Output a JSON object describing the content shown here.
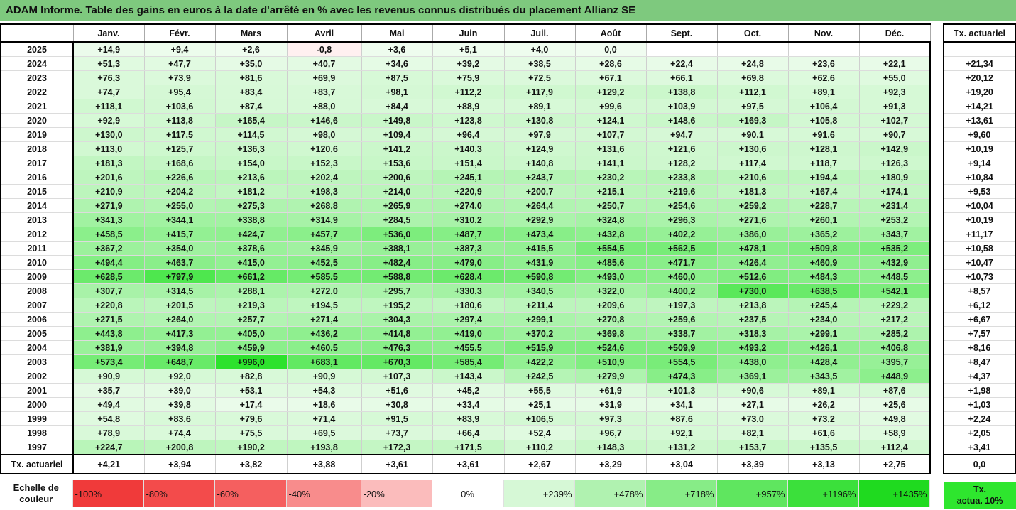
{
  "title": "ADAM Informe. Table des gains en euros à la date d'arrêté en % avec les revenus connus distribués du placement Allianz SE",
  "months": [
    "Janv.",
    "Févr.",
    "Mars",
    "Avril",
    "Mai",
    "Juin",
    "Juil.",
    "Août",
    "Sept.",
    "Oct.",
    "Nov.",
    "Déc."
  ],
  "actuarial_header": "Tx. actuariel",
  "rows": [
    {
      "year": "2025",
      "values": [
        "+14,9",
        "+9,4",
        "+2,6",
        "-0,8",
        "+3,6",
        "+5,1",
        "+4,0",
        "0,0",
        "",
        "",
        "",
        ""
      ],
      "rate": ""
    },
    {
      "year": "2024",
      "values": [
        "+51,3",
        "+47,7",
        "+35,0",
        "+40,7",
        "+34,6",
        "+39,2",
        "+38,5",
        "+28,6",
        "+22,4",
        "+24,8",
        "+23,6",
        "+22,1"
      ],
      "rate": "+21,34"
    },
    {
      "year": "2023",
      "values": [
        "+76,3",
        "+73,9",
        "+81,6",
        "+69,9",
        "+87,5",
        "+75,9",
        "+72,5",
        "+67,1",
        "+66,1",
        "+69,8",
        "+62,6",
        "+55,0"
      ],
      "rate": "+20,12"
    },
    {
      "year": "2022",
      "values": [
        "+74,7",
        "+95,4",
        "+83,4",
        "+83,7",
        "+98,1",
        "+112,2",
        "+117,9",
        "+129,2",
        "+138,8",
        "+112,1",
        "+89,1",
        "+92,3"
      ],
      "rate": "+19,20"
    },
    {
      "year": "2021",
      "values": [
        "+118,1",
        "+103,6",
        "+87,4",
        "+88,0",
        "+84,4",
        "+88,9",
        "+89,1",
        "+99,6",
        "+103,9",
        "+97,5",
        "+106,4",
        "+91,3"
      ],
      "rate": "+14,21"
    },
    {
      "year": "2020",
      "values": [
        "+92,9",
        "+113,8",
        "+165,4",
        "+146,6",
        "+149,8",
        "+123,8",
        "+130,8",
        "+124,1",
        "+148,6",
        "+169,3",
        "+105,8",
        "+102,7"
      ],
      "rate": "+13,61"
    },
    {
      "year": "2019",
      "values": [
        "+130,0",
        "+117,5",
        "+114,5",
        "+98,0",
        "+109,4",
        "+96,4",
        "+97,9",
        "+107,7",
        "+94,7",
        "+90,1",
        "+91,6",
        "+90,7"
      ],
      "rate": "+9,60"
    },
    {
      "year": "2018",
      "values": [
        "+113,0",
        "+125,7",
        "+136,3",
        "+120,6",
        "+141,2",
        "+140,3",
        "+124,9",
        "+131,6",
        "+121,6",
        "+130,6",
        "+128,1",
        "+142,9"
      ],
      "rate": "+10,19"
    },
    {
      "year": "2017",
      "values": [
        "+181,3",
        "+168,6",
        "+154,0",
        "+152,3",
        "+153,6",
        "+151,4",
        "+140,8",
        "+141,1",
        "+128,2",
        "+117,4",
        "+118,7",
        "+126,3"
      ],
      "rate": "+9,14"
    },
    {
      "year": "2016",
      "values": [
        "+201,6",
        "+226,6",
        "+213,6",
        "+202,4",
        "+200,6",
        "+245,1",
        "+243,7",
        "+230,2",
        "+233,8",
        "+210,6",
        "+194,4",
        "+180,9"
      ],
      "rate": "+10,84"
    },
    {
      "year": "2015",
      "values": [
        "+210,9",
        "+204,2",
        "+181,2",
        "+198,3",
        "+214,0",
        "+220,9",
        "+200,7",
        "+215,1",
        "+219,6",
        "+181,3",
        "+167,4",
        "+174,1"
      ],
      "rate": "+9,53"
    },
    {
      "year": "2014",
      "values": [
        "+271,9",
        "+255,0",
        "+275,3",
        "+268,8",
        "+265,9",
        "+274,0",
        "+264,4",
        "+250,7",
        "+254,6",
        "+259,2",
        "+228,7",
        "+231,4"
      ],
      "rate": "+10,04"
    },
    {
      "year": "2013",
      "values": [
        "+341,3",
        "+344,1",
        "+338,8",
        "+314,9",
        "+284,5",
        "+310,2",
        "+292,9",
        "+324,8",
        "+296,3",
        "+271,6",
        "+260,1",
        "+253,2"
      ],
      "rate": "+10,19"
    },
    {
      "year": "2012",
      "values": [
        "+458,5",
        "+415,7",
        "+424,7",
        "+457,7",
        "+536,0",
        "+487,7",
        "+473,4",
        "+432,8",
        "+402,2",
        "+386,0",
        "+365,2",
        "+343,7"
      ],
      "rate": "+11,17"
    },
    {
      "year": "2011",
      "values": [
        "+367,2",
        "+354,0",
        "+378,6",
        "+345,9",
        "+388,1",
        "+387,3",
        "+415,5",
        "+554,5",
        "+562,5",
        "+478,1",
        "+509,8",
        "+535,2"
      ],
      "rate": "+10,58"
    },
    {
      "year": "2010",
      "values": [
        "+494,4",
        "+463,7",
        "+415,0",
        "+452,5",
        "+482,4",
        "+479,0",
        "+431,9",
        "+485,6",
        "+471,7",
        "+426,4",
        "+460,9",
        "+432,9"
      ],
      "rate": "+10,47"
    },
    {
      "year": "2009",
      "values": [
        "+628,5",
        "+797,9",
        "+661,2",
        "+585,5",
        "+588,8",
        "+628,4",
        "+590,8",
        "+493,0",
        "+460,0",
        "+512,6",
        "+484,3",
        "+448,5"
      ],
      "rate": "+10,73"
    },
    {
      "year": "2008",
      "values": [
        "+307,7",
        "+314,5",
        "+288,1",
        "+272,0",
        "+295,7",
        "+330,3",
        "+340,5",
        "+322,0",
        "+400,2",
        "+730,0",
        "+638,5",
        "+542,1"
      ],
      "rate": "+8,57"
    },
    {
      "year": "2007",
      "values": [
        "+220,8",
        "+201,5",
        "+219,3",
        "+194,5",
        "+195,2",
        "+180,6",
        "+211,4",
        "+209,6",
        "+197,3",
        "+213,8",
        "+245,4",
        "+229,2"
      ],
      "rate": "+6,12"
    },
    {
      "year": "2006",
      "values": [
        "+271,5",
        "+264,0",
        "+257,7",
        "+271,4",
        "+304,3",
        "+297,4",
        "+299,1",
        "+270,8",
        "+259,6",
        "+237,5",
        "+234,0",
        "+217,2"
      ],
      "rate": "+6,67"
    },
    {
      "year": "2005",
      "values": [
        "+443,8",
        "+417,3",
        "+405,0",
        "+436,2",
        "+414,8",
        "+419,0",
        "+370,2",
        "+369,8",
        "+338,7",
        "+318,3",
        "+299,1",
        "+285,2"
      ],
      "rate": "+7,57"
    },
    {
      "year": "2004",
      "values": [
        "+381,9",
        "+394,8",
        "+459,9",
        "+460,5",
        "+476,3",
        "+455,5",
        "+515,9",
        "+524,6",
        "+509,9",
        "+493,2",
        "+426,1",
        "+406,8"
      ],
      "rate": "+8,16"
    },
    {
      "year": "2003",
      "values": [
        "+573,4",
        "+648,7",
        "+996,0",
        "+683,1",
        "+670,3",
        "+585,4",
        "+422,2",
        "+510,9",
        "+554,5",
        "+438,0",
        "+428,4",
        "+395,7"
      ],
      "rate": "+8,47"
    },
    {
      "year": "2002",
      "values": [
        "+90,9",
        "+92,0",
        "+82,8",
        "+90,9",
        "+107,3",
        "+143,4",
        "+242,5",
        "+279,9",
        "+474,3",
        "+369,1",
        "+343,5",
        "+448,9"
      ],
      "rate": "+4,37"
    },
    {
      "year": "2001",
      "values": [
        "+35,7",
        "+39,0",
        "+53,1",
        "+54,3",
        "+51,6",
        "+45,2",
        "+55,5",
        "+61,9",
        "+101,3",
        "+90,6",
        "+89,1",
        "+87,6"
      ],
      "rate": "+1,98"
    },
    {
      "year": "2000",
      "values": [
        "+49,4",
        "+39,8",
        "+17,4",
        "+18,6",
        "+30,8",
        "+33,4",
        "+25,1",
        "+31,9",
        "+34,1",
        "+27,1",
        "+26,2",
        "+25,6"
      ],
      "rate": "+1,03"
    },
    {
      "year": "1999",
      "values": [
        "+54,8",
        "+83,6",
        "+79,6",
        "+71,4",
        "+91,5",
        "+83,9",
        "+106,5",
        "+97,3",
        "+87,6",
        "+73,0",
        "+73,2",
        "+49,8"
      ],
      "rate": "+2,24"
    },
    {
      "year": "1998",
      "values": [
        "+78,9",
        "+74,4",
        "+75,5",
        "+69,5",
        "+73,7",
        "+66,4",
        "+52,4",
        "+96,7",
        "+92,1",
        "+82,1",
        "+61,6",
        "+58,9"
      ],
      "rate": "+2,05"
    },
    {
      "year": "1997",
      "values": [
        "+224,7",
        "+200,8",
        "+190,2",
        "+193,8",
        "+172,3",
        "+171,5",
        "+110,2",
        "+148,3",
        "+131,2",
        "+153,7",
        "+135,5",
        "+112,4"
      ],
      "rate": "+3,41"
    }
  ],
  "footer": {
    "label": "Tx. actuariel",
    "values": [
      "+4,21",
      "+3,94",
      "+3,82",
      "+3,88",
      "+3,61",
      "+3,61",
      "+2,67",
      "+3,29",
      "+3,04",
      "+3,39",
      "+3,13",
      "+2,75"
    ],
    "rate": "0,0"
  },
  "color_scale": {
    "label_line1": "Echelle de",
    "label_line2": "couleur",
    "items": [
      {
        "label": "-100%",
        "color": "#f03a3a",
        "align": "left"
      },
      {
        "label": "-80%",
        "color": "#f34b4b",
        "align": "left"
      },
      {
        "label": "-60%",
        "color": "#f55f5f",
        "align": "left"
      },
      {
        "label": "-40%",
        "color": "#f88c8c",
        "align": "left"
      },
      {
        "label": "-20%",
        "color": "#fbbcbc",
        "align": "left"
      },
      {
        "label": "0%",
        "color": "#ffffff",
        "align": "center"
      },
      {
        "label": "+239%",
        "color": "#d6f8d6",
        "align": "right"
      },
      {
        "label": "+478%",
        "color": "#b0f2b0",
        "align": "right"
      },
      {
        "label": "+718%",
        "color": "#87ec87",
        "align": "right"
      },
      {
        "label": "+957%",
        "color": "#5fe65f",
        "align": "right"
      },
      {
        "label": "+1196%",
        "color": "#3be03b",
        "align": "right"
      },
      {
        "label": "+1435%",
        "color": "#1fda1f",
        "align": "right"
      }
    ],
    "actuarial_legend_line1": "Tx.",
    "actuarial_legend_line2": "actua. 10%"
  }
}
